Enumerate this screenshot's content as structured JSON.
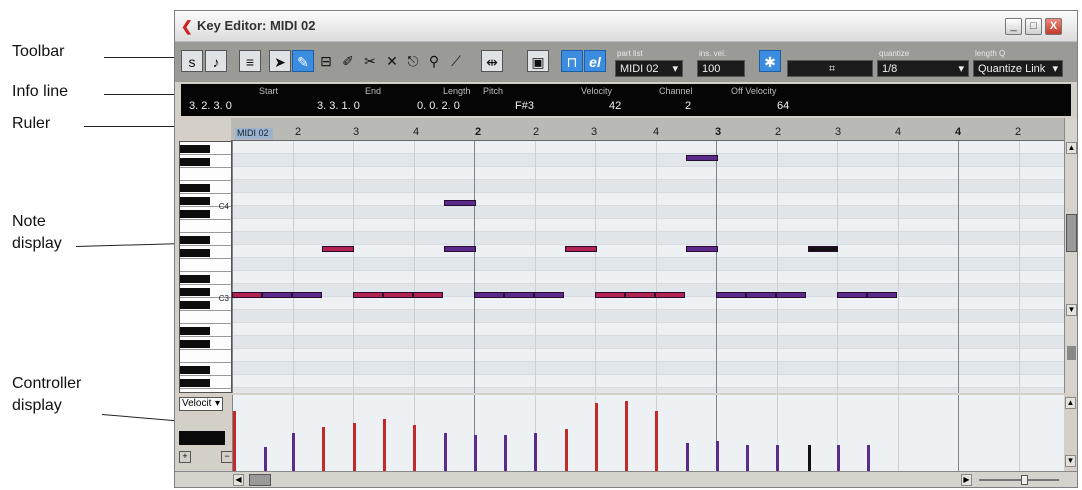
{
  "callouts": {
    "toolbar": "Toolbar",
    "info_line": "Info line",
    "ruler": "Ruler",
    "note_display_1": "Note",
    "note_display_2": "display",
    "controller_display_1": "Controller",
    "controller_display_2": "display"
  },
  "window": {
    "title": "Key Editor: MIDI 02",
    "minimize": "_",
    "maximize": "□",
    "close": "X"
  },
  "toolbar": {
    "part_list_label": "part list",
    "part_list_value": "MIDI 02",
    "ins_vel_label": "ins. vel.",
    "ins_vel_value": "100",
    "quantize_label": "quantize",
    "quantize_value": "1/8",
    "length_q_label": "length Q",
    "length_q_value": "Quantize Link",
    "grid_symbol": "⌗",
    "el_label": "el"
  },
  "info_line": {
    "headers": [
      "Start",
      "End",
      "Length",
      "Pitch",
      "Velocity",
      "Channel",
      "Off Velocity"
    ],
    "start": "3. 2. 3.   0",
    "end": "3. 3. 1.   0",
    "length": "0. 0. 2.   0",
    "pitch": "F#3",
    "velocity": "42",
    "channel": "2",
    "off_velocity": "64"
  },
  "ruler": {
    "part_name": "MIDI 02",
    "labels": [
      "2",
      "3",
      "4",
      "2",
      "2",
      "3",
      "4",
      "3",
      "2",
      "3",
      "4",
      "4",
      "2"
    ]
  },
  "keyboard": {
    "c4_label": "C4",
    "c3_label": "C3"
  },
  "controller": {
    "lane_select": "Velocit"
  },
  "colors": {
    "note_red": "#b3234f",
    "note_purple": "#5b2b8c",
    "note_black": "#111111",
    "vel_red": "#c42a2a",
    "vel_purple": "#5b2b8c",
    "accent_blue": "#3c8de0"
  }
}
